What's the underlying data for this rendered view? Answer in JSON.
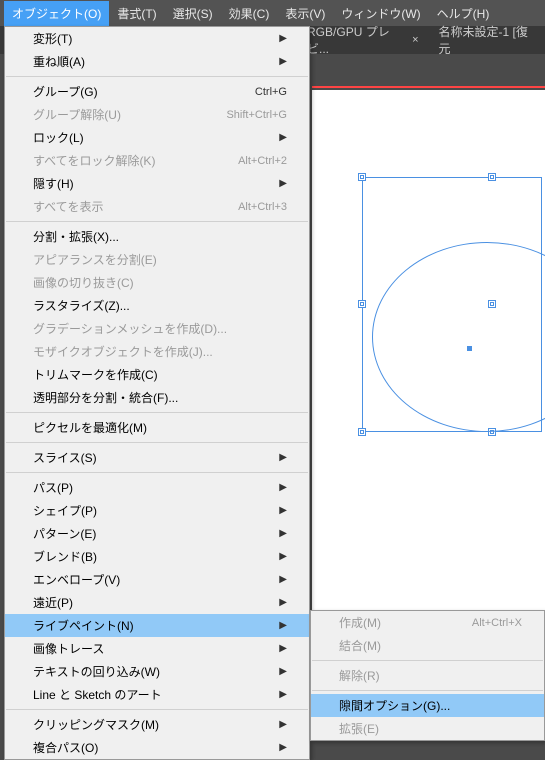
{
  "menubar": {
    "items": [
      {
        "label": "オブジェクト(O)",
        "active": true
      },
      {
        "label": "書式(T)"
      },
      {
        "label": "選択(S)"
      },
      {
        "label": "効果(C)"
      },
      {
        "label": "表示(V)"
      },
      {
        "label": "ウィンドウ(W)"
      },
      {
        "label": "ヘルプ(H)"
      }
    ]
  },
  "tabs": [
    {
      "label": "RGB/GPU プレビ...",
      "close": "×"
    },
    {
      "label": "名称未設定-1 [復元"
    }
  ],
  "menu": [
    {
      "type": "item",
      "label": "変形(T)",
      "submenu": true
    },
    {
      "type": "item",
      "label": "重ね順(A)",
      "submenu": true
    },
    {
      "type": "sep"
    },
    {
      "type": "item",
      "label": "グループ(G)",
      "shortcut": "Ctrl+G"
    },
    {
      "type": "item",
      "label": "グループ解除(U)",
      "shortcut": "Shift+Ctrl+G",
      "disabled": true
    },
    {
      "type": "item",
      "label": "ロック(L)",
      "submenu": true
    },
    {
      "type": "item",
      "label": "すべてをロック解除(K)",
      "shortcut": "Alt+Ctrl+2",
      "disabled": true
    },
    {
      "type": "item",
      "label": "隠す(H)",
      "submenu": true
    },
    {
      "type": "item",
      "label": "すべてを表示",
      "shortcut": "Alt+Ctrl+3",
      "disabled": true
    },
    {
      "type": "sep"
    },
    {
      "type": "item",
      "label": "分割・拡張(X)..."
    },
    {
      "type": "item",
      "label": "アピアランスを分割(E)",
      "disabled": true
    },
    {
      "type": "item",
      "label": "画像の切り抜き(C)",
      "disabled": true
    },
    {
      "type": "item",
      "label": "ラスタライズ(Z)..."
    },
    {
      "type": "item",
      "label": "グラデーションメッシュを作成(D)...",
      "disabled": true
    },
    {
      "type": "item",
      "label": "モザイクオブジェクトを作成(J)...",
      "disabled": true
    },
    {
      "type": "item",
      "label": "トリムマークを作成(C)"
    },
    {
      "type": "item",
      "label": "透明部分を分割・統合(F)..."
    },
    {
      "type": "sep"
    },
    {
      "type": "item",
      "label": "ピクセルを最適化(M)"
    },
    {
      "type": "sep"
    },
    {
      "type": "item",
      "label": "スライス(S)",
      "submenu": true
    },
    {
      "type": "sep"
    },
    {
      "type": "item",
      "label": "パス(P)",
      "submenu": true
    },
    {
      "type": "item",
      "label": "シェイプ(P)",
      "submenu": true
    },
    {
      "type": "item",
      "label": "パターン(E)",
      "submenu": true
    },
    {
      "type": "item",
      "label": "ブレンド(B)",
      "submenu": true
    },
    {
      "type": "item",
      "label": "エンベロープ(V)",
      "submenu": true
    },
    {
      "type": "item",
      "label": "遠近(P)",
      "submenu": true
    },
    {
      "type": "item",
      "label": "ライブペイント(N)",
      "submenu": true,
      "highlighted": true
    },
    {
      "type": "item",
      "label": "画像トレース",
      "submenu": true
    },
    {
      "type": "item",
      "label": "テキストの回り込み(W)",
      "submenu": true
    },
    {
      "type": "item",
      "label": "Line と Sketch のアート",
      "submenu": true
    },
    {
      "type": "sep"
    },
    {
      "type": "item",
      "label": "クリッピングマスク(M)",
      "submenu": true
    },
    {
      "type": "item",
      "label": "複合パス(O)",
      "submenu": true
    }
  ],
  "submenu": [
    {
      "type": "item",
      "label": "作成(M)",
      "shortcut": "Alt+Ctrl+X",
      "disabled": true
    },
    {
      "type": "item",
      "label": "結合(M)",
      "disabled": true
    },
    {
      "type": "sep"
    },
    {
      "type": "item",
      "label": "解除(R)",
      "disabled": true
    },
    {
      "type": "sep"
    },
    {
      "type": "item",
      "label": "隙間オプション(G)...",
      "highlighted": true
    },
    {
      "type": "item",
      "label": "拡張(E)",
      "disabled": true
    }
  ]
}
